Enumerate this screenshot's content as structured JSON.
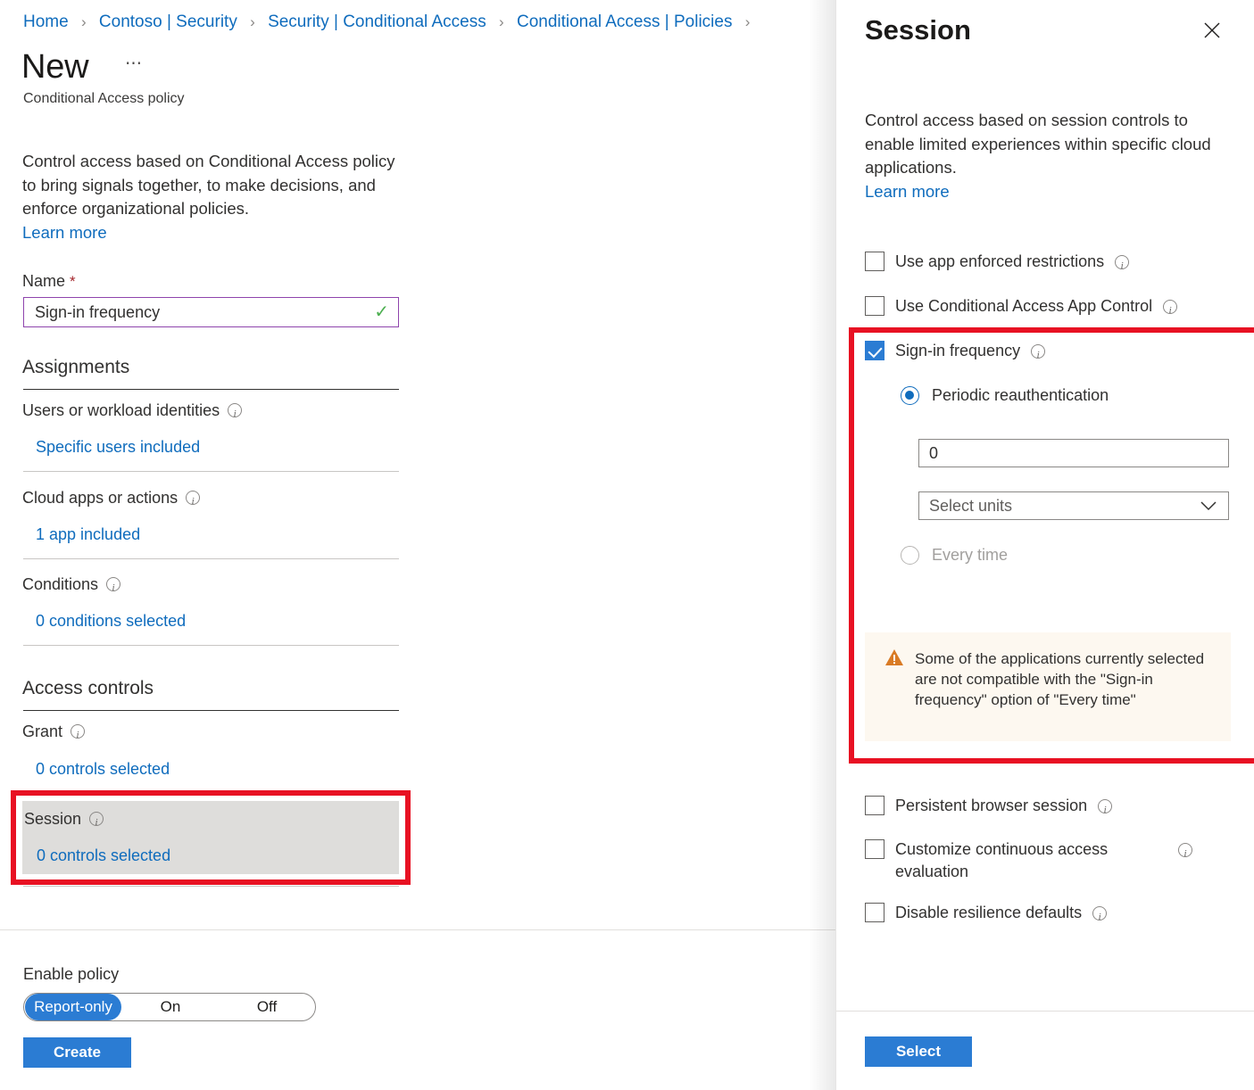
{
  "breadcrumb": {
    "items": [
      "Home",
      "Contoso | Security",
      "Security | Conditional Access",
      "Conditional Access | Policies"
    ],
    "separator": "›"
  },
  "page": {
    "title": "New",
    "ellipsis": "⋯",
    "subtitle": "Conditional Access policy",
    "intro": "Control access based on Conditional Access policy to bring signals together, to make decisions, and enforce organizational policies.",
    "learn_more": "Learn more"
  },
  "form": {
    "name_label": "Name",
    "name_required_marker": "*",
    "name_value": "Sign-in frequency",
    "name_placeholder": "Name",
    "name_valid_glyph": "✓"
  },
  "assignments": {
    "heading": "Assignments",
    "rows": [
      {
        "label": "Users or workload identities",
        "value": "Specific users included"
      },
      {
        "label": "Cloud apps or actions",
        "value": "1 app included"
      },
      {
        "label": "Conditions",
        "value": "0 conditions selected"
      }
    ]
  },
  "access_controls": {
    "heading": "Access controls",
    "grant": {
      "label": "Grant",
      "value": "0 controls selected"
    },
    "session": {
      "label": "Session",
      "value": "0 controls selected"
    }
  },
  "enable_policy": {
    "label": "Enable policy",
    "options": [
      "Report-only",
      "On",
      "Off"
    ],
    "selected": "Report-only"
  },
  "actions": {
    "create_label": "Create"
  },
  "session_blade": {
    "title": "Session",
    "close_glyph": "✕",
    "description": "Control access based on session controls to enable limited experiences within specific cloud applications.",
    "learn_more": "Learn more",
    "checkboxes": [
      {
        "label": "Use app enforced restrictions",
        "checked": false
      },
      {
        "label": "Use Conditional Access App Control",
        "checked": false
      },
      {
        "label": "Sign-in frequency",
        "checked": true
      },
      {
        "label": "Persistent browser session",
        "checked": false
      },
      {
        "label": "Customize continuous access evaluation",
        "checked": false
      },
      {
        "label": "Disable resilience defaults",
        "checked": false
      }
    ],
    "sign_in_frequency": {
      "radio_periodic": "Periodic reauthentication",
      "radio_every_time": "Every time",
      "selected_radio": "Periodic reauthentication",
      "value": "0",
      "value_placeholder": "0",
      "units_value": "Select units",
      "units_placeholder": "Select units",
      "caret_glyph": "⌄",
      "warning": "Some of the applications currently selected are not compatible with the \"Sign-in frequency\" option of \"Every time\"",
      "warning_icon_glyph": "!"
    },
    "select_label": "Select"
  },
  "colors": {
    "accent_blue": "#2b7cd3",
    "link_blue": "#0f6cbd",
    "highlight_red": "#e81123",
    "warning_orange": "#d97b25",
    "row_gray": "#dedddb",
    "warning_bg": "#fdf8f0"
  }
}
